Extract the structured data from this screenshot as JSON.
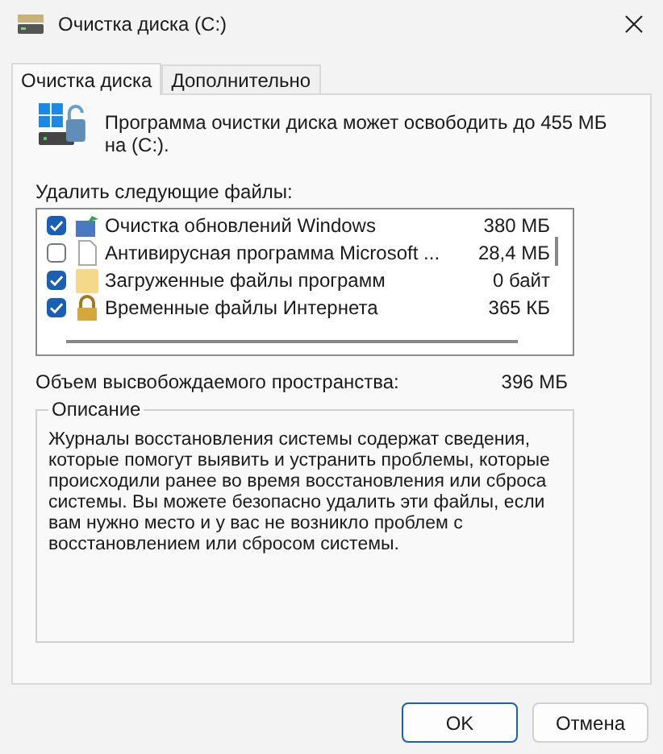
{
  "window": {
    "title": "Очистка диска  (C:)"
  },
  "tabs": [
    {
      "label": "Очистка диска",
      "selected": true
    },
    {
      "label": "Дополнительно",
      "selected": false
    }
  ],
  "header_text": "Программа очистки диска может освободить до 455 МБ на  (C:).",
  "files_label": "Удалить следующие файлы:",
  "files": [
    {
      "name": "Очистка обновлений Windows",
      "size": "380 МБ",
      "checked": true,
      "kind": "update"
    },
    {
      "name": "Антивирусная программа Microsoft ...",
      "size": "28,4 МБ",
      "checked": false,
      "kind": "file"
    },
    {
      "name": "Загруженные файлы программ",
      "size": "0 байт",
      "checked": true,
      "kind": "folder"
    },
    {
      "name": "Временные файлы Интернета",
      "size": "365 КБ",
      "checked": true,
      "kind": "lock"
    }
  ],
  "space_label": "Объем высвобождаемого пространства:",
  "space_value": "396 МБ",
  "description": {
    "title": "Описание",
    "text": "Журналы восстановления системы содержат сведения, которые помогут выявить и устранить проблемы, которые происходили ранее во время восстановления или сброса системы. Вы можете безопасно удалить эти файлы, если вам нужно место и у вас не возникло проблем с восстановлением или сбросом системы."
  },
  "buttons": [
    {
      "label": "OK",
      "default": true
    },
    {
      "label": "Отмена",
      "default": false
    }
  ]
}
